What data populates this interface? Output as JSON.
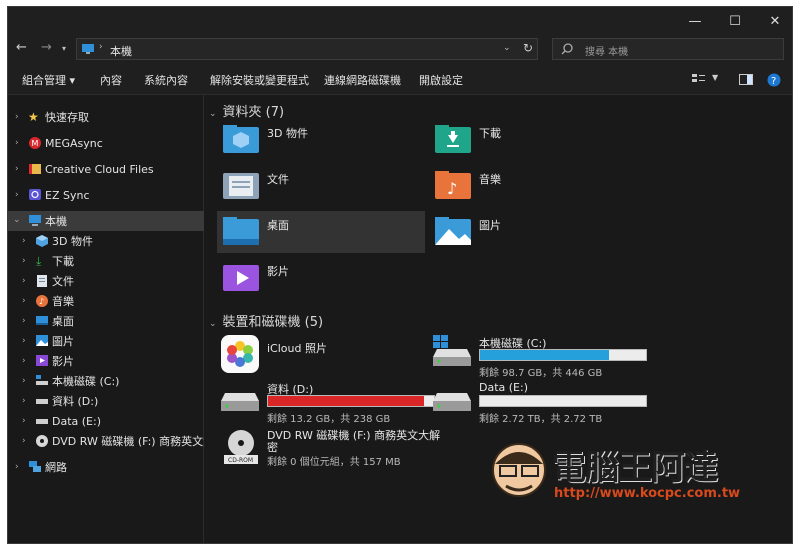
{
  "titlebar": {
    "minimize": "—",
    "maximize": "☐",
    "close": "✕"
  },
  "address": {
    "location": "本機",
    "search_placeholder": "搜尋 本機"
  },
  "toolbar": {
    "organize": "組合管理 ▾",
    "properties": "內容",
    "system_properties": "系統內容",
    "uninstall": "解除安裝或變更程式",
    "map_drive": "連線網路磁碟機",
    "open_settings": "開啟設定"
  },
  "sidebar": {
    "quick_access": "快速存取",
    "megasync": "MEGAsync",
    "creative_cloud": "Creative Cloud Files",
    "ez_sync": "EZ Sync",
    "this_pc": "本機",
    "children": [
      "3D 物件",
      "下載",
      "文件",
      "音樂",
      "桌面",
      "圖片",
      "影片",
      "本機磁碟 (C:)",
      "資料 (D:)",
      "Data (E:)",
      "DVD RW 磁碟機 (F:) 商務英文大解"
    ],
    "network": "網路"
  },
  "folders": {
    "header": "資料夾 (7)",
    "items": [
      "3D 物件",
      "下載",
      "文件",
      "音樂",
      "桌面",
      "圖片",
      "影片"
    ]
  },
  "devices": {
    "header": "裝置和磁碟機 (5)",
    "icloud": "iCloud 照片",
    "c_name": "本機磁碟 (C:)",
    "c_info": "剩餘 98.7 GB，共 446 GB",
    "c_used_fraction": 0.78,
    "d_name": "資料 (D:)",
    "d_info": "剩餘 13.2 GB，共 238 GB",
    "d_used_fraction": 0.94,
    "e_name": "Data (E:)",
    "e_info": "剩餘 2.72 TB，共 2.72 TB",
    "e_used_fraction": 0.0,
    "f_name_1": "DVD RW 磁碟機 (F:) 商務英文大解",
    "f_name_2": "密",
    "f_info": "剩餘 0 個位元組，共 157 MB",
    "cdrom_label": "CD-ROM"
  },
  "watermark": {
    "brand": "電腦王阿達",
    "url": "http://www.kocpc.com.tw"
  },
  "colors": {
    "bar_blue": "#26a0da",
    "bar_red": "#da2626",
    "folder_blue": "#3b9bd9"
  }
}
